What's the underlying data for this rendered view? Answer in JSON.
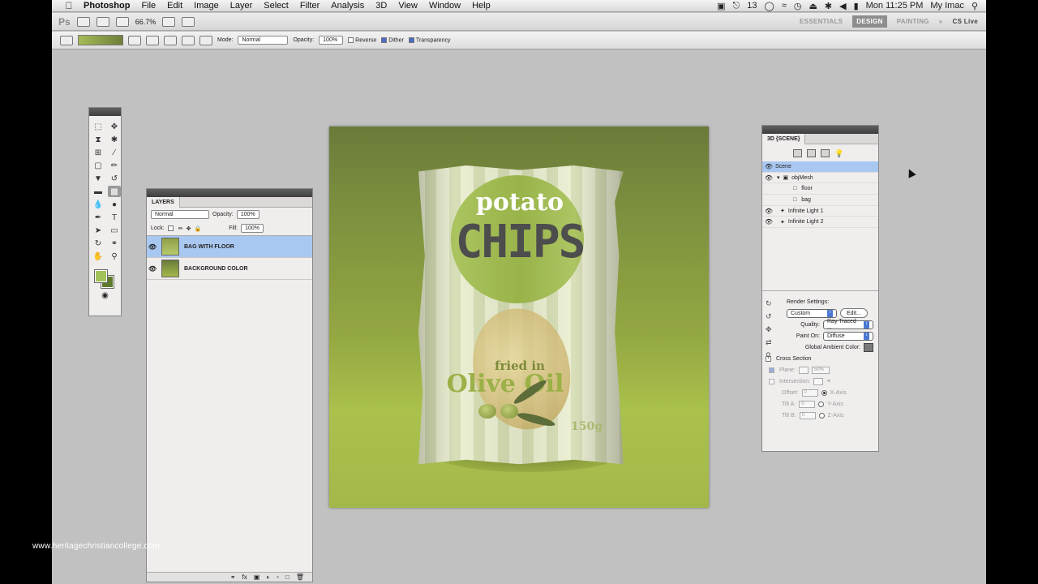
{
  "menubar": {
    "app": "Photoshop",
    "items": [
      "File",
      "Edit",
      "Image",
      "Layer",
      "Select",
      "Filter",
      "Analysis",
      "3D",
      "View",
      "Window",
      "Help"
    ],
    "status": {
      "badge_count": "13",
      "clock": "Mon 11:25 PM",
      "user": "My Imac"
    }
  },
  "appbar": {
    "logo": "Ps",
    "zoom": "66.7%",
    "workspaces": [
      "ESSENTIALS",
      "DESIGN",
      "PAINTING"
    ],
    "active_workspace": "DESIGN",
    "more": "»",
    "cs_live": "CS Live"
  },
  "options": {
    "mode_label": "Mode:",
    "mode_value": "Normal",
    "opacity_label": "Opacity:",
    "opacity_value": "100%",
    "reverse": "Reverse",
    "dither": "Dither",
    "transparency": "Transparency"
  },
  "layers_panel": {
    "tab": "LAYERS",
    "blend_mode": "Normal",
    "opacity_label": "Opacity:",
    "opacity_value": "100%",
    "lock_label": "Lock:",
    "fill_label": "Fill:",
    "fill_value": "100%",
    "items": [
      {
        "name": "BAG WITH FLOOR",
        "selected": true
      },
      {
        "name": "BACKGROUND COLOR",
        "selected": false
      }
    ]
  },
  "canvas": {
    "bag_text": {
      "line1": "potato",
      "line2": "CHIPS",
      "line3": "fried in",
      "line4": "Olive Oil",
      "weight": "150g"
    }
  },
  "scene_panel": {
    "tab": "3D {SCENE}",
    "tree": [
      {
        "label": "Scene",
        "indent": 0,
        "selected": true
      },
      {
        "label": "objMesh",
        "indent": 1,
        "selected": false
      },
      {
        "label": "floor",
        "indent": 2,
        "selected": false
      },
      {
        "label": "bag",
        "indent": 2,
        "selected": false
      },
      {
        "label": "Infinite Light 1",
        "indent": 1,
        "selected": false
      },
      {
        "label": "Infinite Light 2",
        "indent": 1,
        "selected": false
      }
    ],
    "render": {
      "title": "Render Settings:",
      "preset": "Custom",
      "edit": "Edit...",
      "quality_label": "Quality:",
      "quality_value": "Ray Traced ...",
      "paint_on_label": "Paint On:",
      "paint_on_value": "Diffuse",
      "ambient_label": "Global Ambient Color:",
      "cross_section": "Cross Section",
      "plane": "Plane:",
      "plane_value": "50%",
      "intersection": "Intersection:",
      "offset": "Offset:",
      "offset_value": "0",
      "tilt_a": "Tilt A:",
      "tilt_a_value": "0",
      "tilt_b": "Tilt B:",
      "tilt_b_value": "0",
      "x_axis": "X-Axis",
      "y_axis": "Y-Axis",
      "z_axis": "Z-Axis"
    }
  },
  "watermark": "www.heritagechristiancollege.com",
  "colors": {
    "foreground": "#a2c25b",
    "background": "#5f7a2b",
    "selection": "#a9c8f1"
  }
}
